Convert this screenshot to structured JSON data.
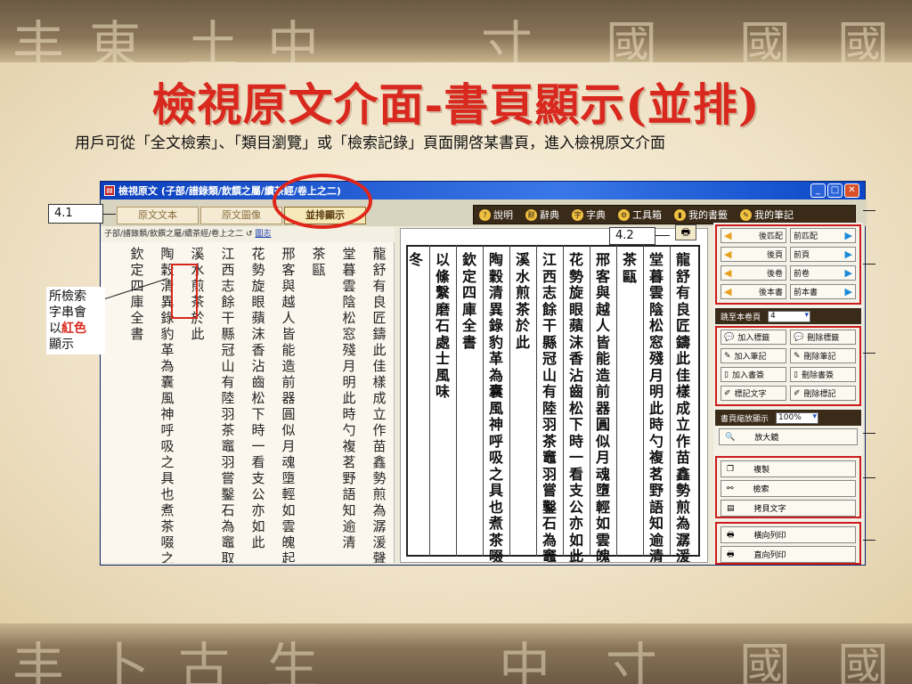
{
  "slide": {
    "title": "檢視原文介面-書頁顯示(並排)",
    "subtitle": "用戶可從「全文檢索」、「類目瀏覽」或「檢索記錄」頁面開啓某書頁，進入檢視原文介面",
    "bg_glyphs_top": [
      "丰",
      "東",
      "土",
      "中",
      "寸",
      "國",
      "國",
      "國"
    ],
    "bg_glyphs_bottom": [
      "丰",
      "卜",
      "古",
      "生",
      "中",
      "寸",
      "國",
      "國"
    ]
  },
  "window": {
    "title": "檢視原文 (子部/譜錄類/飲饌之屬/續茶經/卷上之二)",
    "tabs": [
      "原文文本",
      "原文圖像",
      "並排顯示"
    ],
    "active_tab": 2,
    "tools": [
      "說明",
      "辭典",
      "字典",
      "工具箱",
      "我的書籤",
      "我的筆記"
    ],
    "path": "子部/譜錄類/飲饌之屬/續茶經/卷上之二",
    "path_link": "圖志"
  },
  "text_columns": [
    "龍舒有良匠鑄此佳樣成立作苗鑫勢煎為潺湲聲草",
    "堂暮雲陰松窓殘月明此時勺複茗野語知逾清",
    "茶甌",
    "邢客與越人皆能造前器圓似月魂墮輕如雲魄起棗",
    "花勢旋眼蘋沫香沾齒松下時一看支公亦如此",
    "江西志餘干縣冠山有陸羽茶竈羽嘗鑿石為竈取越",
    "溪水煎茶於此",
    "陶穀清異錄豹革為囊風神呼吸之具也煮茶啜之可",
    "欽定四庫全書"
  ],
  "image_columns": [
    "龍舒有良匠鑄此佳樣成立作苗鑫勢煎為潺湲聲草",
    "堂暮雲陰松窓殘月明此時勺複茗野語知逾清",
    "茶甌",
    "邢客與越人皆能造前器圓似月魂墮輕如雲魄起棗",
    "花勢旋眼蘋沫香沾齒松下時一看支公亦如此",
    "江西志餘干縣冠山有陸羽茶竈羽嘗鑿石為竈取越",
    "溪水煎茶於此",
    "陶穀清異錄豹革為囊風神呼吸之具也煮茶啜之可",
    "欽定四庫全書",
    "以絛繫磨石處士風味",
    "冬"
  ],
  "controls": {
    "nav_rows": [
      [
        "後匹配",
        "前匹配"
      ],
      [
        "後頁",
        "前頁"
      ],
      [
        "後卷",
        "前卷"
      ],
      [
        "後本書",
        "前本書"
      ]
    ],
    "jump_label": "跳至本卷頁",
    "jump_value": "4",
    "mark_rows": [
      [
        "加入標籤",
        "刪除標籤"
      ],
      [
        "加入筆記",
        "刪除筆記"
      ],
      [
        "加入書簽",
        "刪除書簽"
      ],
      [
        "標記文字",
        "刪除標記"
      ]
    ],
    "zoom_label": "書頁縮放顯示",
    "zoom_value": "100%",
    "magnifier": "放大鏡",
    "copy": "複製",
    "search": "檢索",
    "copy_text": "拷貝文字",
    "print_landscape": "橫向列印",
    "print_portrait": "直向列印"
  },
  "callouts": {
    "c41": "4.1",
    "c42": "4.2",
    "note_line1": "所檢索",
    "note_line2": "字串會",
    "note_line3a": "以",
    "note_line3b": "紅色",
    "note_line4": "顯示"
  },
  "colors": {
    "title_red": "#d9281e",
    "highlight_red": "#cc1a1a",
    "titlebar_blue": "#0b3fbd"
  }
}
